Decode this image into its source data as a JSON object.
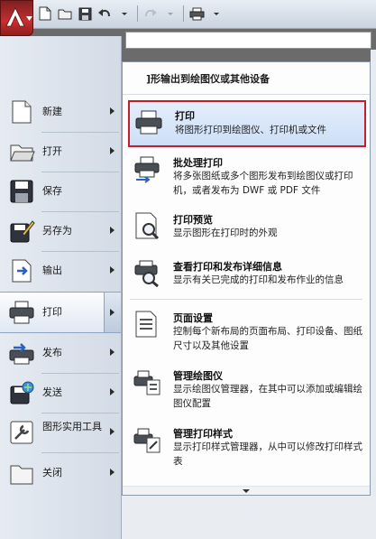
{
  "toolbar": {
    "app_button_icon": "autocad-a-logo-icon",
    "quick_access": [
      "new-file-icon",
      "open-folder-icon",
      "save-icon",
      "undo-icon",
      "redo-icon",
      "plot-icon"
    ]
  },
  "search": {
    "value": "",
    "placeholder": ""
  },
  "left_menu": {
    "items": [
      {
        "label": "新建",
        "icon": "new-document-icon",
        "has_submenu": true
      },
      {
        "label": "打开",
        "icon": "open-folder-icon",
        "has_submenu": true
      },
      {
        "label": "保存",
        "icon": "save-disk-icon",
        "has_submenu": false
      },
      {
        "label": "另存为",
        "icon": "save-as-icon",
        "has_submenu": true
      },
      {
        "label": "输出",
        "icon": "export-icon",
        "has_submenu": true
      },
      {
        "label": "打印",
        "icon": "printer-icon",
        "has_submenu": true,
        "active": true
      },
      {
        "label": "发布",
        "icon": "publish-icon",
        "has_submenu": true
      },
      {
        "label": "发送",
        "icon": "send-icon",
        "has_submenu": true
      },
      {
        "label": "图形实用工具",
        "icon": "drawing-utilities-icon",
        "has_submenu": true
      },
      {
        "label": "关闭",
        "icon": "close-folder-icon",
        "has_submenu": true
      }
    ]
  },
  "submenu": {
    "header": "]形输出到绘图仪或其他设备",
    "items": [
      {
        "title": "打印",
        "description": "将图形打印到绘图仪、打印机或文件",
        "icon": "plot-printer-icon",
        "selected": true
      },
      {
        "title": "批处理打印",
        "description": "将多张图纸或多个图形发布到绘图仪或打印机，或者发布为 DWF 或 PDF 文件",
        "icon": "batch-plot-icon"
      },
      {
        "title": "打印预览",
        "description": "显示图形在打印时的外观",
        "icon": "plot-preview-icon"
      },
      {
        "title": "查看打印和发布详细信息",
        "description": "显示有关已完成的打印和发布作业的信息",
        "icon": "plot-details-icon"
      },
      {
        "title": "页面设置",
        "description": "控制每个新布局的页面布局、打印设备、图纸尺寸以及其他设置",
        "icon": "page-setup-icon"
      },
      {
        "title": "管理绘图仪",
        "description": "显示绘图仪管理器，在其中可以添加或编辑绘图仪配置",
        "icon": "manage-plotters-icon"
      },
      {
        "title": "管理打印样式",
        "description": "显示打印样式管理器，从中可以修改打印样式表",
        "icon": "manage-plot-styles-icon"
      }
    ]
  },
  "colors": {
    "selection_border": "#c41d2b",
    "app_button": "#c62f2f"
  }
}
